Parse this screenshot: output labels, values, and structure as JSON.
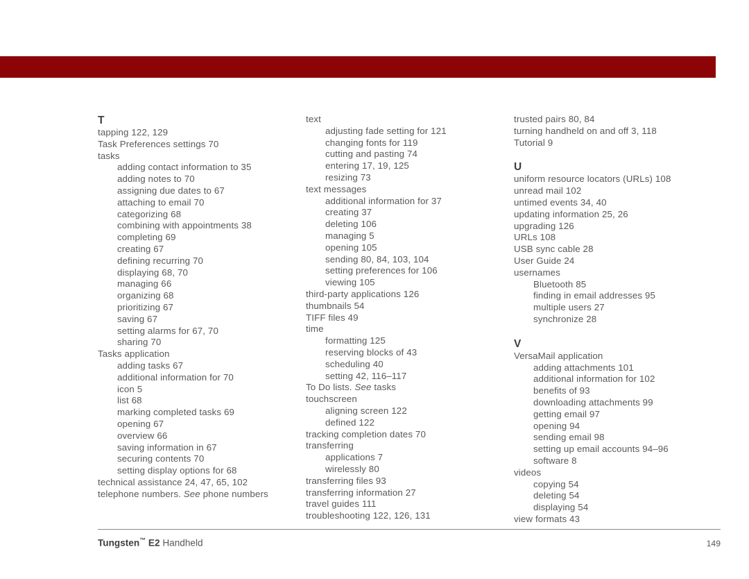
{
  "header": {
    "bar_color": "#8c0405"
  },
  "document": {
    "type": "index",
    "text_color": "#58585a"
  },
  "columns": [
    {
      "id": "column-1",
      "entries": [
        {
          "kind": "letter",
          "text": "T",
          "spaced": false
        },
        {
          "kind": "main",
          "text": "tapping 122, 129"
        },
        {
          "kind": "main",
          "text": "Task Preferences settings 70"
        },
        {
          "kind": "main",
          "text": "tasks"
        },
        {
          "kind": "sub",
          "text": "adding contact information to 35"
        },
        {
          "kind": "sub",
          "text": "adding notes to 70"
        },
        {
          "kind": "sub",
          "text": "assigning due dates to 67"
        },
        {
          "kind": "sub",
          "text": "attaching to email 70"
        },
        {
          "kind": "sub",
          "text": "categorizing 68"
        },
        {
          "kind": "sub",
          "text": "combining with appointments 38"
        },
        {
          "kind": "sub",
          "text": "completing 69"
        },
        {
          "kind": "sub",
          "text": "creating 67"
        },
        {
          "kind": "sub",
          "text": "defining recurring 70"
        },
        {
          "kind": "sub",
          "text": "displaying 68, 70"
        },
        {
          "kind": "sub",
          "text": "managing 66"
        },
        {
          "kind": "sub",
          "text": "organizing 68"
        },
        {
          "kind": "sub",
          "text": "prioritizing 67"
        },
        {
          "kind": "sub",
          "text": "saving 67"
        },
        {
          "kind": "sub",
          "text": "setting alarms for 67, 70"
        },
        {
          "kind": "sub",
          "text": "sharing 70"
        },
        {
          "kind": "main",
          "text": "Tasks application"
        },
        {
          "kind": "sub",
          "text": "adding tasks 67"
        },
        {
          "kind": "sub",
          "text": "additional information for 70"
        },
        {
          "kind": "sub",
          "text": "icon 5"
        },
        {
          "kind": "sub",
          "text": "list 68"
        },
        {
          "kind": "sub",
          "text": "marking completed tasks 69"
        },
        {
          "kind": "sub",
          "text": "opening 67"
        },
        {
          "kind": "sub",
          "text": "overview 66"
        },
        {
          "kind": "sub",
          "text": "saving information in 67"
        },
        {
          "kind": "sub",
          "text": "securing contents 70"
        },
        {
          "kind": "sub",
          "text": "setting display options for 68"
        },
        {
          "kind": "main",
          "text": "technical assistance 24, 47, 65, 102"
        },
        {
          "kind": "main",
          "html": "telephone numbers. <span class=\"ital\">See</span> phone numbers",
          "text": "telephone numbers. See phone numbers"
        }
      ]
    },
    {
      "id": "column-2",
      "entries": [
        {
          "kind": "main",
          "text": "text"
        },
        {
          "kind": "sub",
          "text": "adjusting fade setting for 121"
        },
        {
          "kind": "sub",
          "text": "changing fonts for 119"
        },
        {
          "kind": "sub",
          "text": "cutting and pasting 74"
        },
        {
          "kind": "sub",
          "text": "entering 17, 19, 125"
        },
        {
          "kind": "sub",
          "text": "resizing 73"
        },
        {
          "kind": "main",
          "text": "text messages"
        },
        {
          "kind": "sub",
          "text": "additional information for 37"
        },
        {
          "kind": "sub",
          "text": "creating 37"
        },
        {
          "kind": "sub",
          "text": "deleting 106"
        },
        {
          "kind": "sub",
          "text": "managing 5"
        },
        {
          "kind": "sub",
          "text": "opening 105"
        },
        {
          "kind": "sub",
          "text": "sending 80, 84, 103, 104"
        },
        {
          "kind": "sub",
          "text": "setting preferences for 106"
        },
        {
          "kind": "sub",
          "text": "viewing 105"
        },
        {
          "kind": "main",
          "text": "third-party applications 126"
        },
        {
          "kind": "main",
          "text": "thumbnails 54"
        },
        {
          "kind": "main",
          "text": "TIFF files 49"
        },
        {
          "kind": "main",
          "text": "time"
        },
        {
          "kind": "sub",
          "text": "formatting 125"
        },
        {
          "kind": "sub",
          "text": "reserving blocks of 43"
        },
        {
          "kind": "sub",
          "text": "scheduling 40"
        },
        {
          "kind": "sub",
          "text": "setting 42, 116–117"
        },
        {
          "kind": "main",
          "html": "To Do lists. <span class=\"ital\">See</span> tasks",
          "text": "To Do lists. See tasks"
        },
        {
          "kind": "main",
          "text": "touchscreen"
        },
        {
          "kind": "sub",
          "text": "aligning screen 122"
        },
        {
          "kind": "sub",
          "text": "defined 122"
        },
        {
          "kind": "main",
          "text": "tracking completion dates 70"
        },
        {
          "kind": "main",
          "text": "transferring"
        },
        {
          "kind": "sub",
          "text": "applications 7"
        },
        {
          "kind": "sub",
          "text": "wirelessly 80"
        },
        {
          "kind": "main",
          "text": "transferring files 93"
        },
        {
          "kind": "main",
          "text": "transferring information 27"
        },
        {
          "kind": "main",
          "text": "travel guides 111"
        },
        {
          "kind": "main",
          "text": "troubleshooting 122, 126, 131"
        }
      ]
    },
    {
      "id": "column-3",
      "entries": [
        {
          "kind": "main",
          "text": "trusted pairs 80, 84"
        },
        {
          "kind": "main",
          "text": "turning handheld on and off 3, 118"
        },
        {
          "kind": "main",
          "text": "Tutorial 9"
        },
        {
          "kind": "letter",
          "text": "U",
          "spaced": true
        },
        {
          "kind": "main",
          "text": "uniform resource locators (URLs) 108"
        },
        {
          "kind": "main",
          "text": "unread mail 102"
        },
        {
          "kind": "main",
          "text": "untimed events 34, 40"
        },
        {
          "kind": "main",
          "text": "updating information 25, 26"
        },
        {
          "kind": "main",
          "text": "upgrading 126"
        },
        {
          "kind": "main",
          "text": "URLs 108"
        },
        {
          "kind": "main",
          "text": "USB sync cable 28"
        },
        {
          "kind": "main",
          "text": "User Guide 24"
        },
        {
          "kind": "main",
          "text": "usernames"
        },
        {
          "kind": "sub",
          "text": "Bluetooth 85"
        },
        {
          "kind": "sub",
          "text": "finding in email addresses 95"
        },
        {
          "kind": "sub",
          "text": "multiple users 27"
        },
        {
          "kind": "sub",
          "text": "synchronize 28"
        },
        {
          "kind": "letter",
          "text": "V",
          "spaced": true
        },
        {
          "kind": "main",
          "text": "VersaMail application"
        },
        {
          "kind": "sub",
          "text": "adding attachments 101"
        },
        {
          "kind": "sub",
          "text": "additional information for 102"
        },
        {
          "kind": "sub",
          "text": "benefits of 93"
        },
        {
          "kind": "sub",
          "text": "downloading attachments 99"
        },
        {
          "kind": "sub",
          "text": "getting email 97"
        },
        {
          "kind": "sub",
          "text": "opening 94"
        },
        {
          "kind": "sub",
          "text": "sending email 98"
        },
        {
          "kind": "sub",
          "text": "setting up email accounts 94–96"
        },
        {
          "kind": "sub",
          "text": "software 8"
        },
        {
          "kind": "main",
          "text": "videos"
        },
        {
          "kind": "sub",
          "text": "copying 54"
        },
        {
          "kind": "sub",
          "text": "deleting 54"
        },
        {
          "kind": "sub",
          "text": "displaying 54"
        },
        {
          "kind": "main",
          "text": "view formats 43"
        }
      ]
    }
  ],
  "footer": {
    "brand": "Tungsten",
    "trademark": "™",
    "model": " E2",
    "product": " Handheld",
    "page_number": "149"
  }
}
